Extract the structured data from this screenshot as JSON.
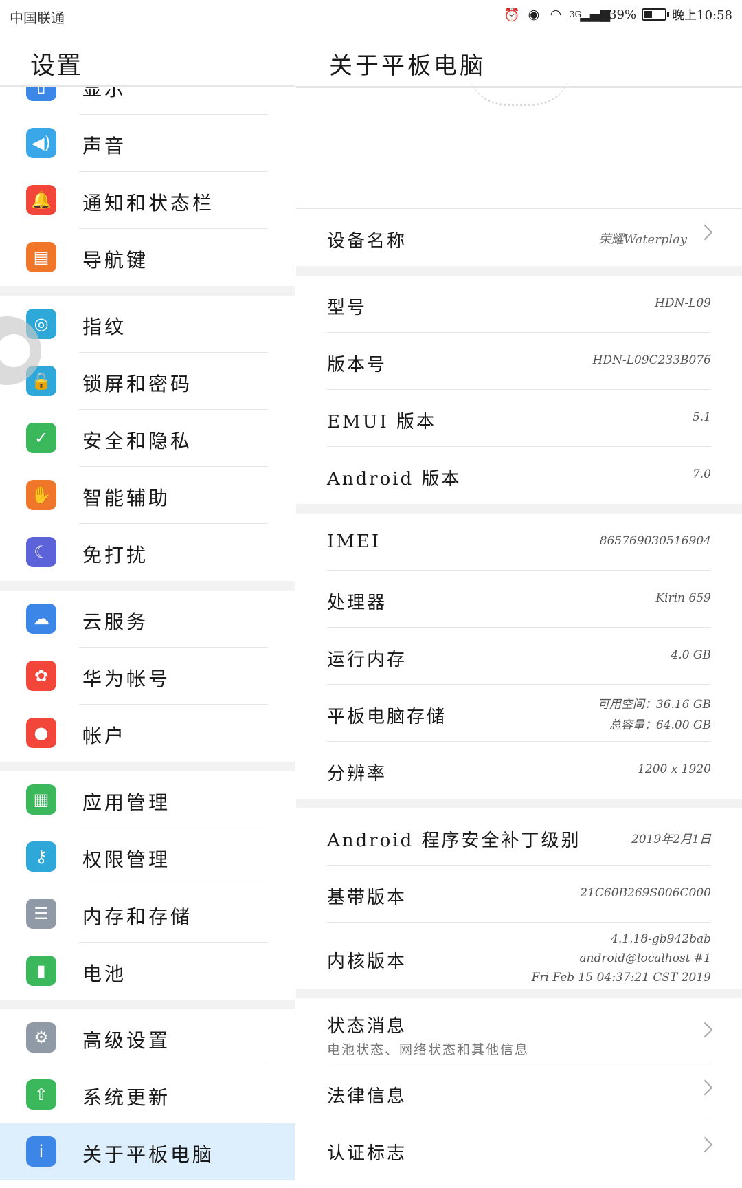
{
  "status_bar": {
    "carrier": "中国联通",
    "network": "3G",
    "battery_percent_text": "39%",
    "battery_level": 0.39,
    "time": "晚上10:58",
    "icons": [
      "alarm-icon",
      "eye-icon",
      "wifi-icon",
      "signal-icon",
      "battery-icon"
    ]
  },
  "sidebar": {
    "title": "设置",
    "items": [
      {
        "label": "显示",
        "icon": "display-icon",
        "color": "#3b86e6"
      },
      {
        "label": "声音",
        "icon": "sound-icon",
        "color": "#3aa8e8"
      },
      {
        "label": "通知和状态栏",
        "icon": "bell-icon",
        "color": "#f2463a"
      },
      {
        "label": "导航键",
        "icon": "navigation-key-icon",
        "color": "#f0772a"
      },
      {
        "label": "指纹",
        "icon": "fingerprint-icon",
        "color": "#2ea8d8"
      },
      {
        "label": "锁屏和密码",
        "icon": "lock-icon",
        "color": "#2ea8d8"
      },
      {
        "label": "安全和隐私",
        "icon": "shield-icon",
        "color": "#3cb85c"
      },
      {
        "label": "智能辅助",
        "icon": "hand-icon",
        "color": "#f0772a"
      },
      {
        "label": "免打扰",
        "icon": "moon-icon",
        "color": "#5c63d8"
      },
      {
        "label": "云服务",
        "icon": "cloud-icon",
        "color": "#3b86e6"
      },
      {
        "label": "华为帐号",
        "icon": "huawei-icon",
        "color": "#f2463a"
      },
      {
        "label": "帐户",
        "icon": "account-icon",
        "color": "#f2463a"
      },
      {
        "label": "应用管理",
        "icon": "apps-icon",
        "color": "#3cb85c"
      },
      {
        "label": "权限管理",
        "icon": "key-icon",
        "color": "#2ea8d8"
      },
      {
        "label": "内存和存储",
        "icon": "storage-icon",
        "color": "#8f9aa6"
      },
      {
        "label": "电池",
        "icon": "battery-icon",
        "color": "#3cb85c"
      },
      {
        "label": "高级设置",
        "icon": "gear-icon",
        "color": "#8f9aa6"
      },
      {
        "label": "系统更新",
        "icon": "update-icon",
        "color": "#3cb85c"
      },
      {
        "label": "关于平板电脑",
        "icon": "info-icon",
        "color": "#3b86e6"
      }
    ]
  },
  "about": {
    "title": "关于平板电脑",
    "device_name": {
      "label": "设备名称",
      "value": "荣耀Waterplay"
    },
    "model": {
      "label": "型号",
      "value": "HDN-L09"
    },
    "build": {
      "label": "版本号",
      "value": "HDN-L09C233B076"
    },
    "emui": {
      "label": "EMUI 版本",
      "value": "5.1"
    },
    "android": {
      "label": "Android 版本",
      "value": "7.0"
    },
    "imei": {
      "label": "IMEI",
      "value": "865769030516904"
    },
    "processor": {
      "label": "处理器",
      "value": "Kirin 659"
    },
    "ram": {
      "label": "运行内存",
      "value": "4.0 GB"
    },
    "storage": {
      "label": "平板电脑存储",
      "available": "可用空间：36.16 GB",
      "total": "总容量：64.00 GB"
    },
    "resolution": {
      "label": "分辨率",
      "value": "1200 x 1920"
    },
    "security_patch": {
      "label": "Android 程序安全补丁级别",
      "value": "2019年2月1日"
    },
    "baseband": {
      "label": "基带版本",
      "value": "21C60B269S006C000"
    },
    "kernel": {
      "label": "内核版本",
      "line1": "4.1.18-gb942bab",
      "line2": "android@localhost #1",
      "line3": "Fri Feb 15 04:37:21 CST 2019"
    },
    "status": {
      "label": "状态消息",
      "sub": "电池状态、网络状态和其他信息"
    },
    "legal": {
      "label": "法律信息"
    },
    "certification": {
      "label": "认证标志"
    }
  }
}
